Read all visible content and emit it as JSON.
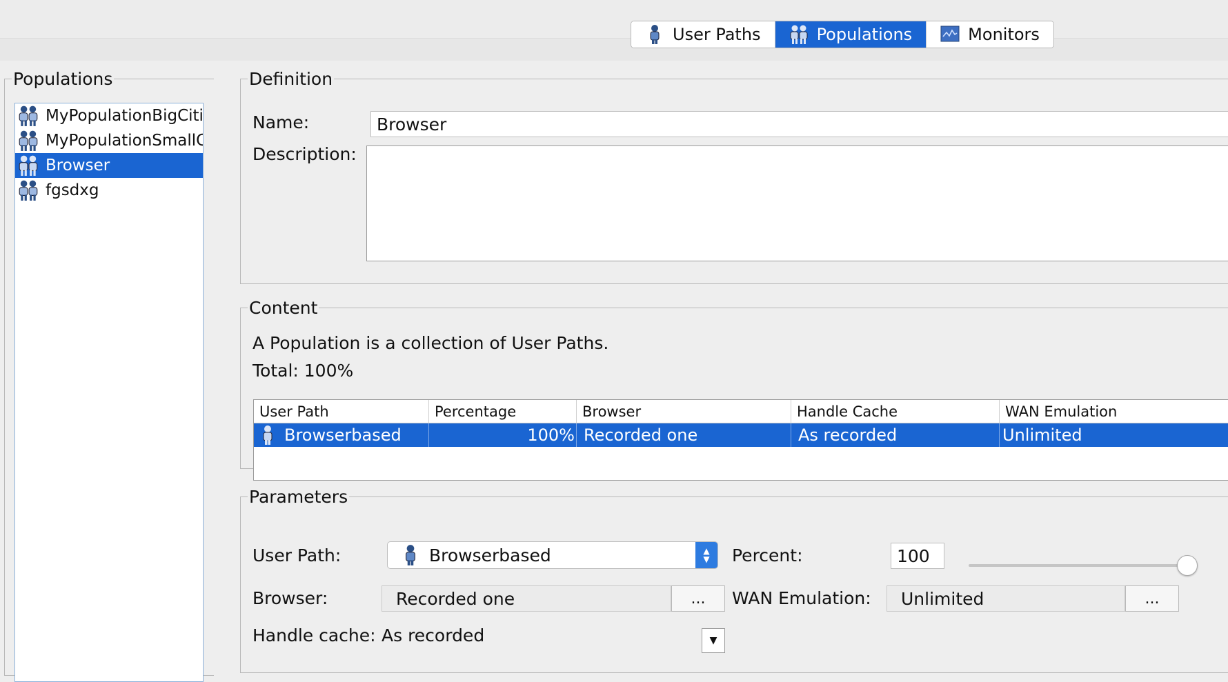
{
  "tabs": [
    {
      "label": "User Paths",
      "icon": "user-path-icon",
      "active": false
    },
    {
      "label": "Populations",
      "icon": "population-icon",
      "active": true
    },
    {
      "label": "Monitors",
      "icon": "monitor-icon",
      "active": false
    }
  ],
  "populations": {
    "title": "Populations",
    "items": [
      {
        "label": "MyPopulationBigCities"
      },
      {
        "label": "MyPopulationSmallCities"
      },
      {
        "label": "Browser",
        "selected": true
      },
      {
        "label": "fgsdxg"
      }
    ]
  },
  "definition": {
    "title": "Definition",
    "name_label": "Name:",
    "name_value": "Browser",
    "description_label": "Description:",
    "description_value": ""
  },
  "content": {
    "title": "Content",
    "info": "A Population is a collection of User Paths.",
    "total": "Total: 100%",
    "columns": [
      "User Path",
      "Percentage",
      "Browser",
      "Handle Cache",
      "WAN Emulation"
    ],
    "rows": [
      {
        "user_path": "Browserbased",
        "percentage": "100%",
        "browser": "Recorded one",
        "handle_cache": "As recorded",
        "wan": "Unlimited"
      }
    ]
  },
  "parameters": {
    "title": "Parameters",
    "user_path_label": "User Path:",
    "user_path_value": "Browserbased",
    "percent_label": "Percent:",
    "percent_value": "100",
    "percent_slider": 1.0,
    "browser_label": "Browser:",
    "browser_value": "Recorded one",
    "wan_label": "WAN Emulation:",
    "wan_value": "Unlimited",
    "handle_cache_label": "Handle cache:",
    "handle_cache_value": "As recorded",
    "ellipsis": "..."
  },
  "colors": {
    "accent": "#1a65d2"
  }
}
